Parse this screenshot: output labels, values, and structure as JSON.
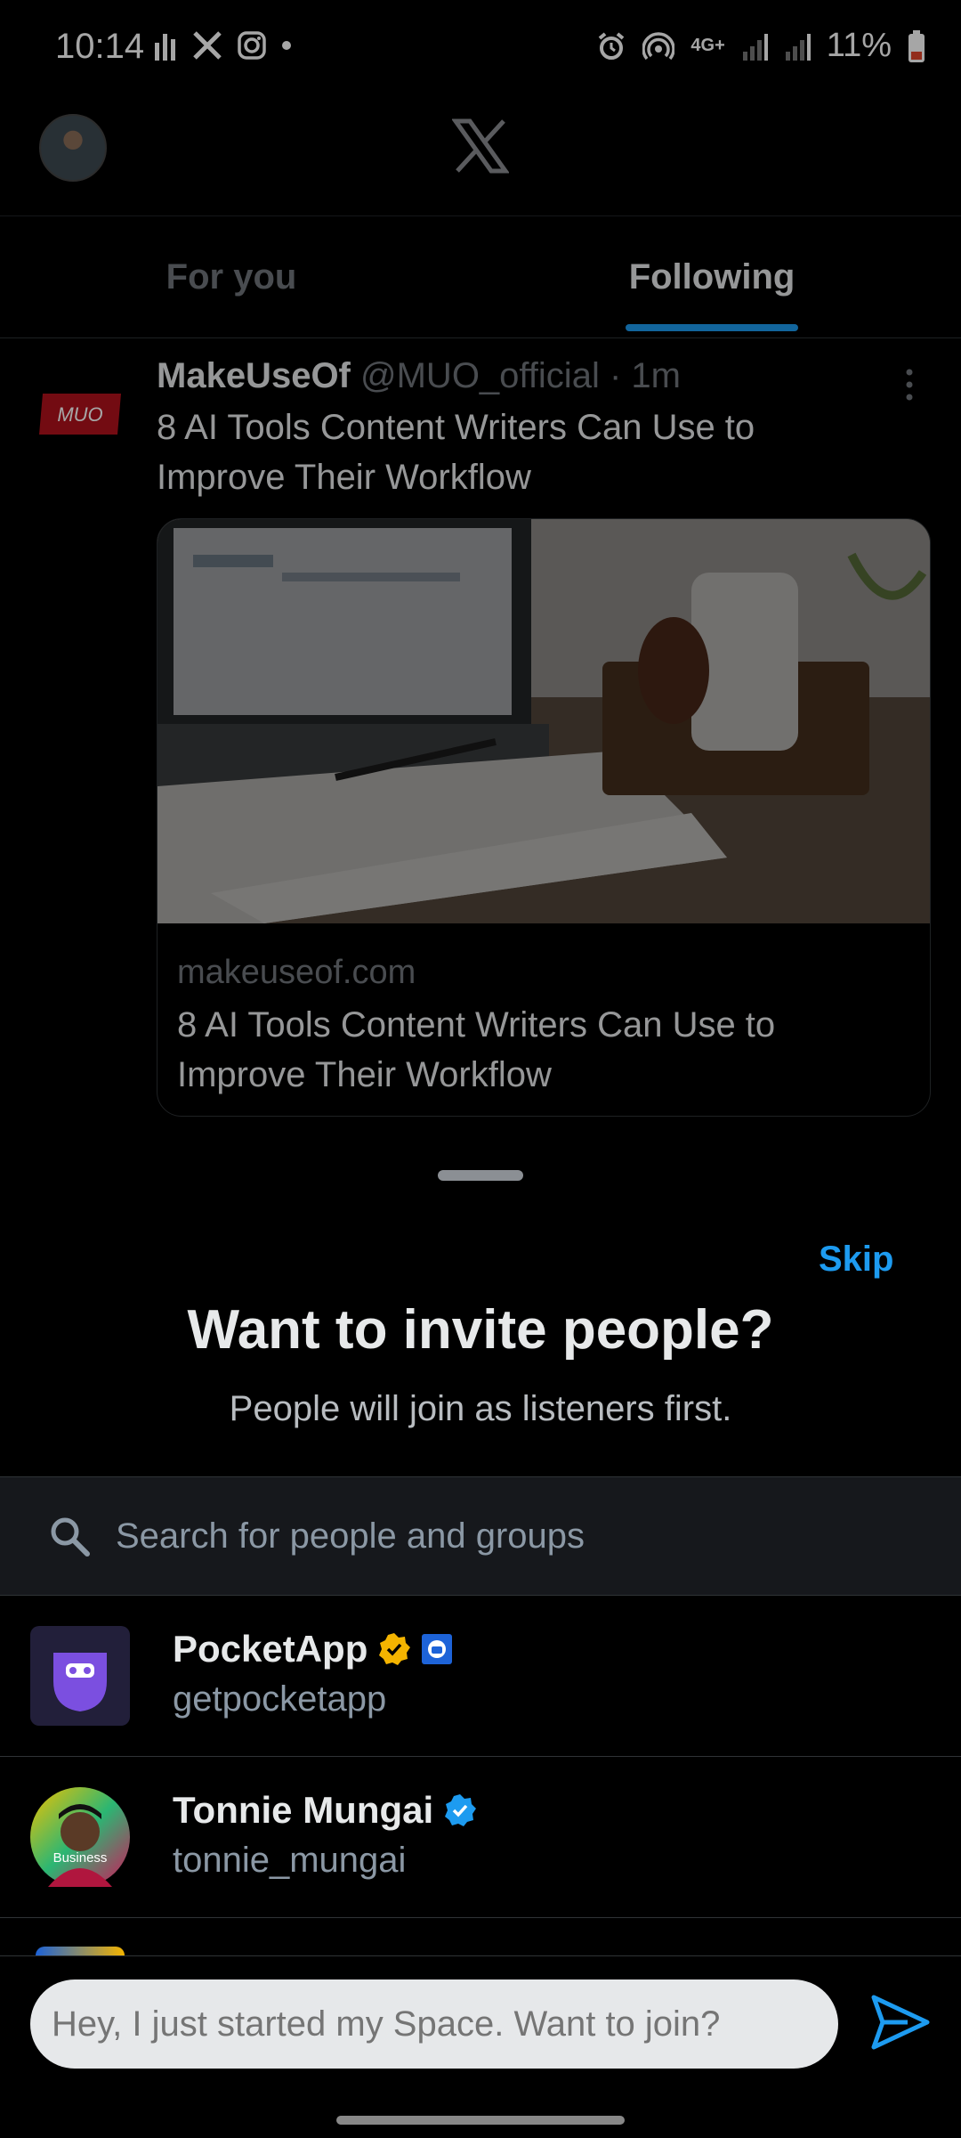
{
  "status_bar": {
    "time": "10:14",
    "battery": "11%",
    "network": "4G+"
  },
  "header": {
    "logo_name": "x-logo"
  },
  "tabs": [
    {
      "label": "For you"
    },
    {
      "label": "Following"
    }
  ],
  "tweet": {
    "author": "MakeUseOf",
    "handle": "@MUO_official",
    "time": "· 1m",
    "logo_text": "MUO",
    "text": "8 AI Tools Content Writers Can Use to Improve Their Workflow",
    "card": {
      "domain": "makeuseof.com",
      "title": "8 AI Tools Content Writers Can Use to Improve Their Workflow"
    }
  },
  "invite_sheet": {
    "skip_label": "Skip",
    "title": "Want to invite people?",
    "subtitle": "People will join as listeners first.",
    "search_placeholder": "Search for people and groups",
    "people": [
      {
        "name": "PocketApp",
        "handle": "getpocketapp"
      },
      {
        "name": "Tonnie Mungai",
        "handle": "tonnie_mungai",
        "avatar_badge": "Business"
      }
    ]
  },
  "composer": {
    "placeholder": "Hey, I just started my Space. Want to join?"
  },
  "colors": {
    "accent": "#1d9bf0",
    "background": "#000000",
    "gold_check": "#f4b400"
  }
}
